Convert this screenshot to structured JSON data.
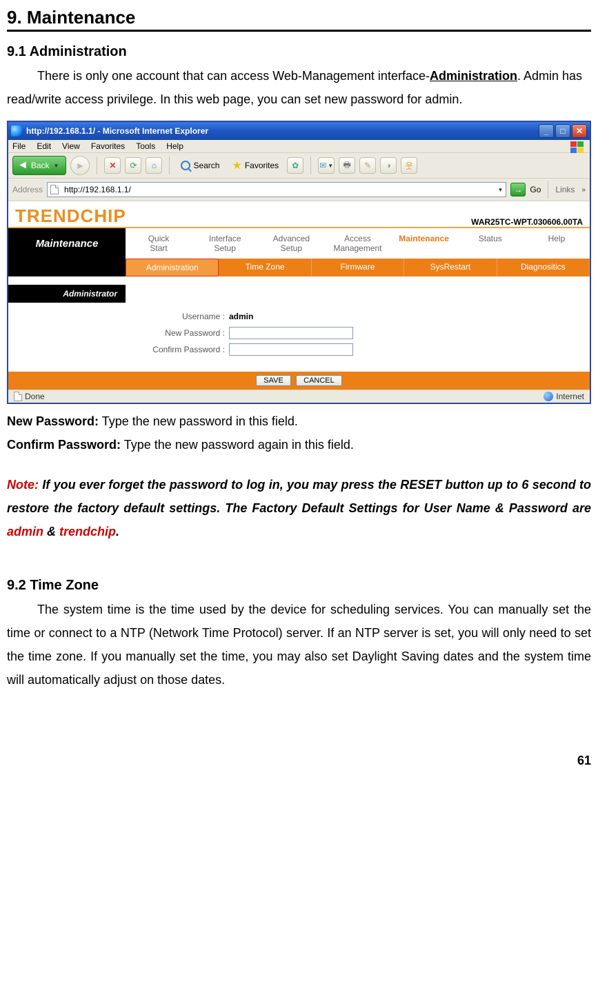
{
  "headings": {
    "chapter": "9. Maintenance",
    "sec1": "9.1    Administration",
    "sec2": "9.2 Time Zone"
  },
  "para1": {
    "lead": "There is only one account that can access Web-Management interface-",
    "link": "Administration",
    "tail": ". Admin has read/write access privilege. In this web page, you can set new password for admin."
  },
  "fields": {
    "newpw_lbl": "New Password:",
    "newpw_txt": " Type the new password in this field.",
    "confpw_lbl": "Confirm Password:",
    "confpw_txt": " Type the new password again in this field."
  },
  "note": {
    "prefix": "Note:",
    "t1": " If you ever forget the password to log in, you may press the RESET button up to 6 second to restore the factory default settings. The Factory Default Settings for User Name & Password are ",
    "user": "admin",
    "amp": " & ",
    "pass": "trendchip",
    "dot": "."
  },
  "tz_para": "The system time is the time used by the device for scheduling services. You can manually set the time or connect to a NTP (Network Time Protocol) server. If an NTP server is set, you will only need to set the time zone. If you manually set the time, you may also set Daylight Saving dates and the system time will automatically adjust on those dates.",
  "page_number": "61",
  "browser": {
    "title": "http://192.168.1.1/ - Microsoft Internet Explorer",
    "menu": [
      "File",
      "Edit",
      "View",
      "Favorites",
      "Tools",
      "Help"
    ],
    "back": "Back",
    "search": "Search",
    "favorites": "Favorites",
    "address_lbl": "Address",
    "address_val": "http://192.168.1.1/",
    "go": "Go",
    "links": "Links",
    "status_done": "Done",
    "status_zone": "Internet"
  },
  "router": {
    "brand": "TRENDCHIP",
    "version": "WAR25TC-WPT.030606.00TA",
    "nav_left": "Maintenance",
    "tabs": {
      "quick": "Quick\nStart",
      "iface": "Interface\nSetup",
      "adv": "Advanced\nSetup",
      "access": "Access\nManagement",
      "maint": "Maintenance",
      "status": "Status",
      "help": "Help"
    },
    "subtabs": {
      "admin": "Administration",
      "tz": "Time Zone",
      "fw": "Firmware",
      "sys": "SysRestart",
      "diag": "Diagnositics"
    },
    "section_label": "Administrator",
    "form": {
      "user_lbl": "Username :",
      "user_val": "admin",
      "newpw_lbl": "New Password :",
      "confpw_lbl": "Confirm Password :"
    },
    "buttons": {
      "save": "SAVE",
      "cancel": "CANCEL"
    }
  }
}
